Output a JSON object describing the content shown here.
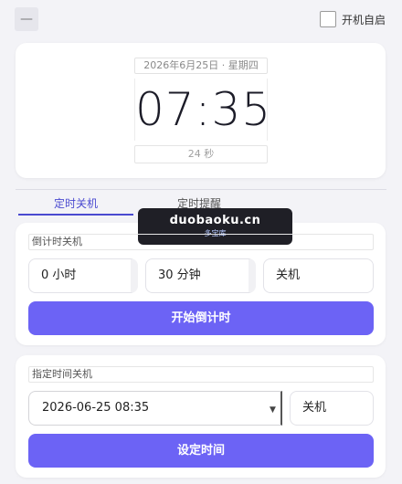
{
  "topbar": {
    "menu_icon": "minus-icon",
    "autostart_label": "开机自启",
    "autostart_checked": false
  },
  "clock": {
    "date": "2026年6月25日 · 星期四",
    "time": "07:35",
    "seconds": "24 秒"
  },
  "tabs": [
    {
      "label": "定时关机",
      "active": true
    },
    {
      "label": "定时提醒",
      "active": false
    }
  ],
  "watermark": {
    "title": "duobaoku.cn",
    "subtitle": "多宝库"
  },
  "countdown": {
    "section_label": "倒计时关机",
    "hours": "0 小时",
    "minutes": "30 分钟",
    "action": "关机",
    "button": "开始倒计时"
  },
  "scheduled": {
    "section_label": "指定时间关机",
    "datetime": "2026-06-25  08:35",
    "action": "关机",
    "button": "设定时间"
  },
  "colors": {
    "accent": "#6c63f5",
    "tab_active": "#4a4ad0",
    "background": "#f3f3f7"
  }
}
